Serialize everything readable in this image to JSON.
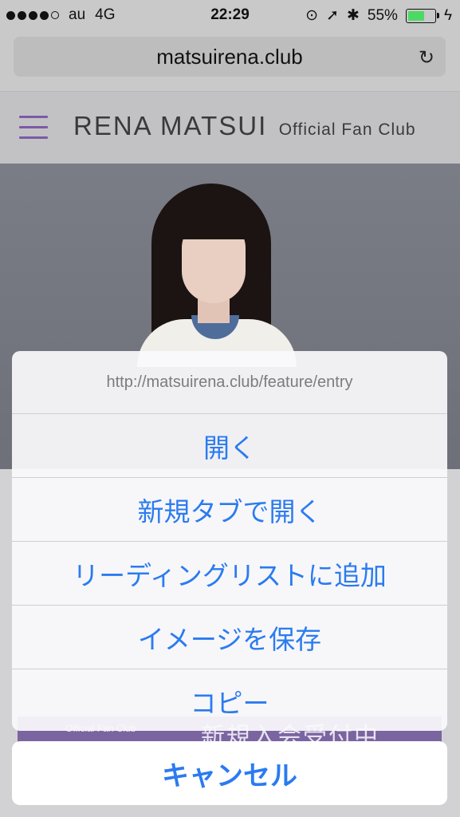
{
  "status_bar": {
    "carrier": "au",
    "network": "4G",
    "time": "22:29",
    "battery": "55%",
    "battery_level": 0.55,
    "icons": [
      "signal-dots-icon",
      "rotation-lock-icon",
      "location-arrow-icon",
      "bluetooth-icon",
      "battery-icon",
      "charging-bolt-icon"
    ]
  },
  "browser": {
    "url": "matsuirena.club",
    "reload_icon": "reload-icon"
  },
  "site": {
    "menu_icon": "hamburger-menu-icon",
    "brand_name": "RENA MATSUI",
    "brand_sub": "Official Fan Club",
    "accent_color": "#7b5aa6"
  },
  "banner_under": {
    "small": "Official Fan Club",
    "big": "新規入会受付中"
  },
  "action_sheet": {
    "link_url": "http://matsuirena.club/feature/entry",
    "items": [
      {
        "label": "開く"
      },
      {
        "label": "新規タブで開く"
      },
      {
        "label": "リーディングリストに追加"
      },
      {
        "label": "イメージを保存"
      },
      {
        "label": "コピー"
      }
    ],
    "cancel_label": "キャンセル",
    "action_color": "#2b7bf0"
  }
}
